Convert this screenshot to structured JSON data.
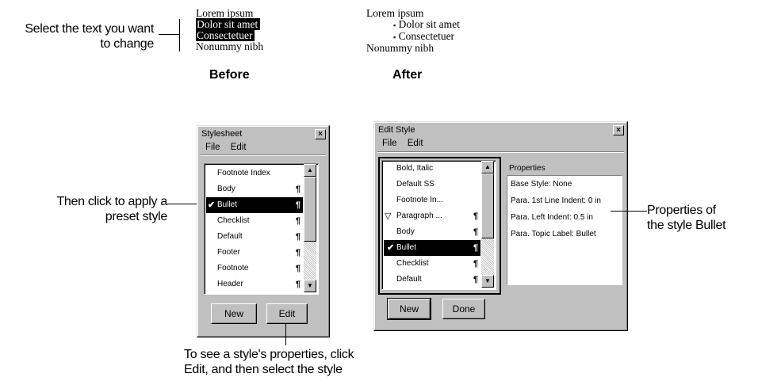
{
  "callouts": {
    "select_text_line1": "Select the text you want",
    "select_text_line2": "to change",
    "apply_line1": "Then click to apply a",
    "apply_line2": "preset style",
    "props_line1": "Properties of",
    "props_line2": "the style Bullet",
    "edit_line1": "To see a style's properties, click",
    "edit_line2": "Edit, and then select the style"
  },
  "before": {
    "caption": "Before",
    "lines": [
      "Lorem ipsum",
      "Dolor sit amet",
      "Consectetuer",
      "Nonummy nibh"
    ]
  },
  "after": {
    "caption": "After",
    "lines": [
      "Lorem ipsum",
      "Dolor sit amet",
      "Consectetuer",
      "Nonummy nibh"
    ],
    "bullet": "▪"
  },
  "stylesheet_window": {
    "title": "Stylesheet",
    "close": "×",
    "menu": [
      "File",
      "Edit"
    ],
    "items": [
      {
        "label": "Footnote Index",
        "para": ""
      },
      {
        "label": "Body",
        "para": "¶"
      },
      {
        "label": "Bullet",
        "para": "¶",
        "selected": true
      },
      {
        "label": "Checklist",
        "para": "¶"
      },
      {
        "label": "Default",
        "para": "¶"
      },
      {
        "label": "Footer",
        "para": "¶"
      },
      {
        "label": "Footnote",
        "para": "¶"
      },
      {
        "label": "Header",
        "para": "¶"
      }
    ],
    "new_button": "New",
    "edit_button": "Edit"
  },
  "edit_style_window": {
    "title": "Edit Style",
    "close": "×",
    "menu": [
      "File",
      "Edit"
    ],
    "items": [
      {
        "label": "Bold, Italic",
        "para": ""
      },
      {
        "label": "Default SS",
        "para": ""
      },
      {
        "label": "Footnote In...",
        "para": ""
      },
      {
        "label": "Paragraph ...",
        "para": "¶",
        "expander": "▽"
      },
      {
        "label": "Body",
        "para": "¶"
      },
      {
        "label": "Bullet",
        "para": "¶",
        "selected": true
      },
      {
        "label": "Checklist",
        "para": "¶"
      },
      {
        "label": "Default",
        "para": "¶"
      }
    ],
    "properties_label": "Properties",
    "properties": [
      "Base Style: None",
      "Para. 1st Line Indent: 0 in",
      "Para. Left Indent: 0.5 in",
      "Para. Topic Label: Bullet"
    ],
    "new_button": "New",
    "done_button": "Done"
  },
  "glyphs": {
    "check": "✔",
    "scroll_up": "▲",
    "scroll_down": "▼"
  }
}
